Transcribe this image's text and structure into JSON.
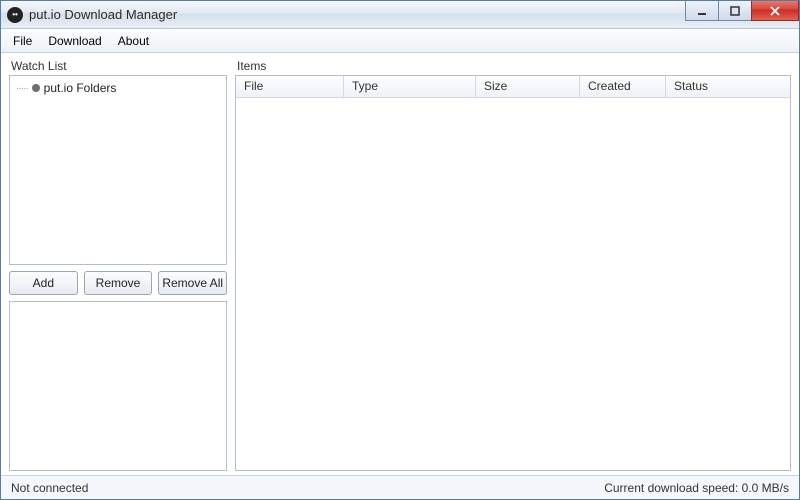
{
  "window": {
    "title": "put.io Download Manager"
  },
  "menu": {
    "file": "File",
    "download": "Download",
    "about": "About"
  },
  "watchlist": {
    "label": "Watch List",
    "root_item": "put.io Folders",
    "buttons": {
      "add": "Add",
      "remove": "Remove",
      "remove_all": "Remove All"
    }
  },
  "items": {
    "label": "Items",
    "columns": {
      "file": "File",
      "type": "Type",
      "size": "Size",
      "created": "Created",
      "status": "Status"
    }
  },
  "status": {
    "connection": "Not connected",
    "speed": "Current download speed: 0.0 MB/s"
  }
}
